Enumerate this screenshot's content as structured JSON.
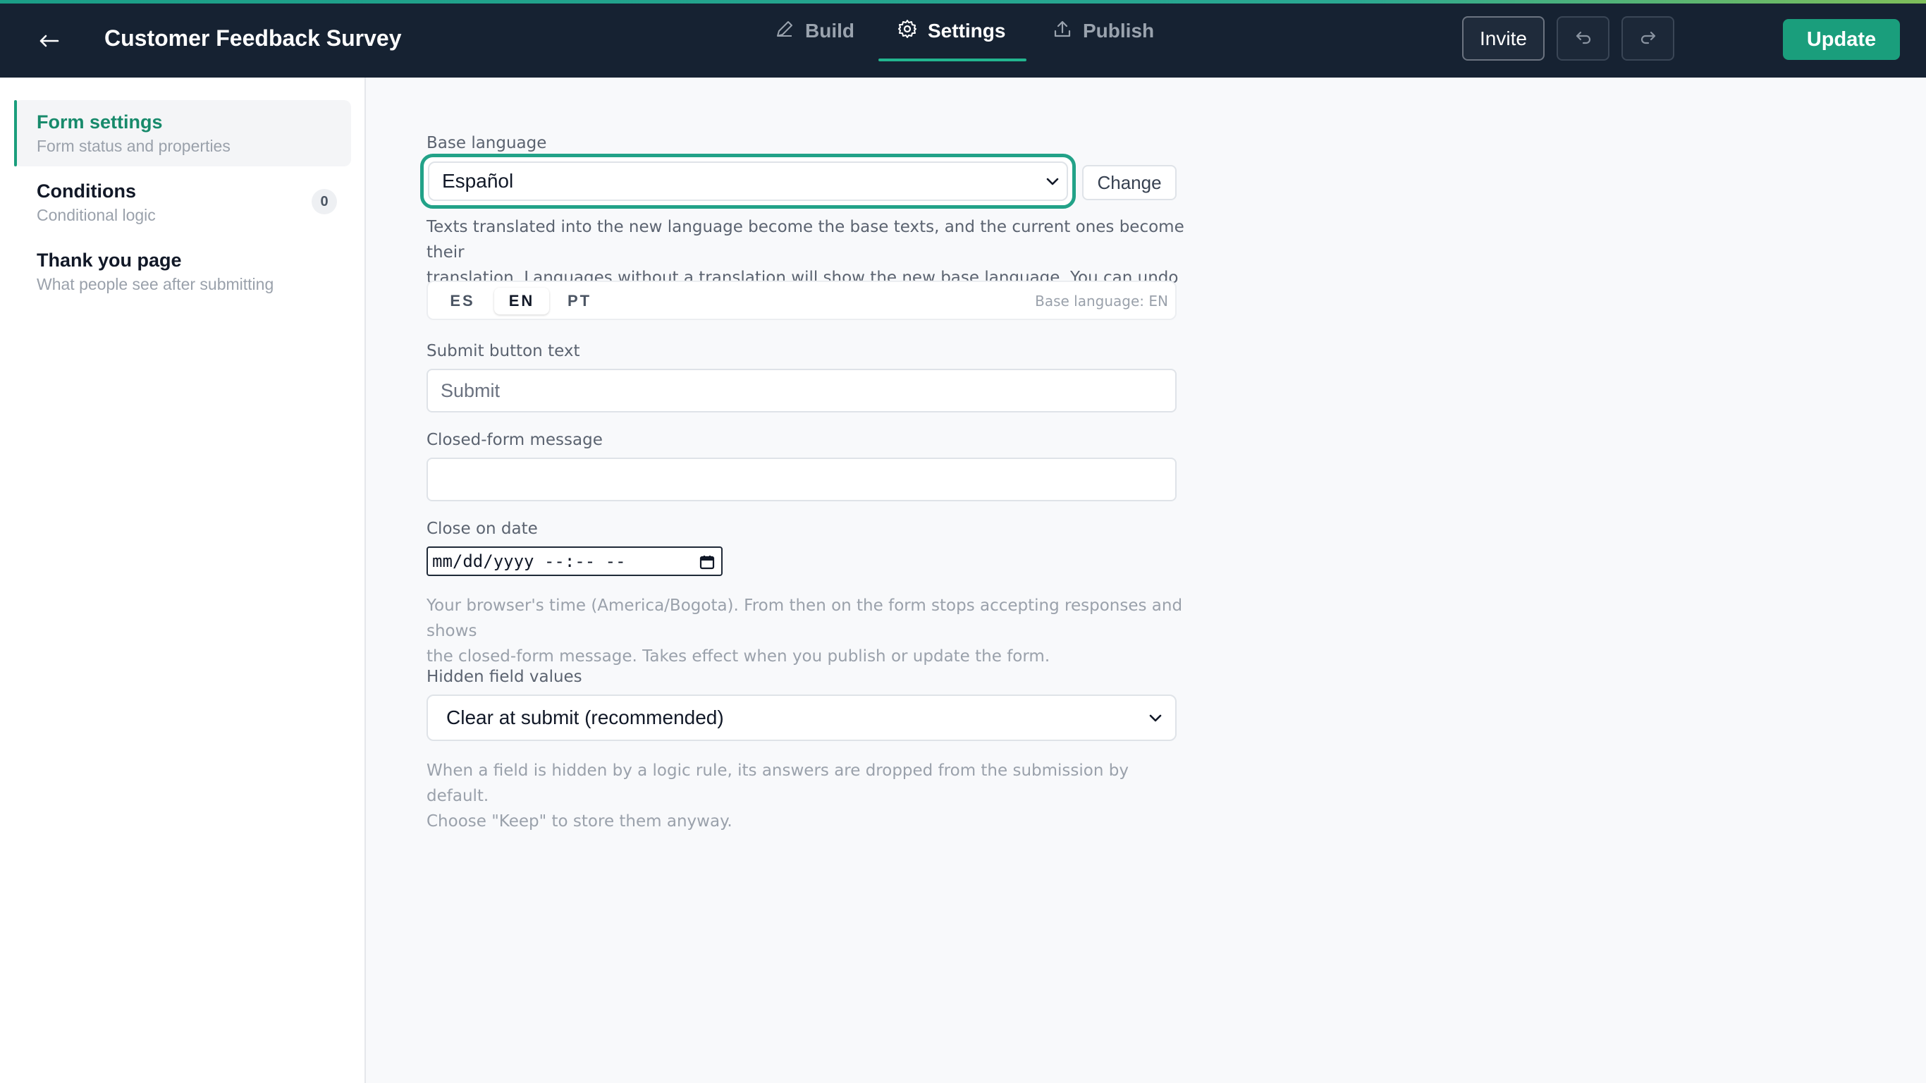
{
  "header": {
    "title": "Customer Feedback Survey",
    "tabs": {
      "build": "Build",
      "settings": "Settings",
      "publish": "Publish"
    },
    "invite_label": "Invite",
    "update_label": "Update"
  },
  "sidebar": {
    "items": [
      {
        "label": "Form settings",
        "sub": "Form status and properties"
      },
      {
        "label": "Conditions",
        "sub": "Conditional logic",
        "badge": "0"
      },
      {
        "label": "Thank you page",
        "sub": "What people see after submitting"
      }
    ]
  },
  "settings": {
    "base_language_label": "Base language",
    "base_language_value": "Español",
    "change_label": "Change",
    "base_language_help": [
      "Texts translated into the new language become the base texts, and the current ones become their",
      "translation. Languages without a translation will show the new base language. You can undo this."
    ],
    "language_tabs": [
      "ES",
      "EN",
      "PT"
    ],
    "active_language": "EN",
    "base_language_indicator": "Base language: EN",
    "submit_label": "Submit button text",
    "submit_placeholder": "Submit",
    "closed_label": "Closed-form message",
    "closed_value": "",
    "close_date_label": "Close on date",
    "close_date_value": "mm/dd/yyyy --:-- --",
    "close_date_help": [
      "Your browser's time (America/Bogota). From then on the form stops accepting responses and shows",
      "the closed-form message. Takes effect when you publish or update the form."
    ],
    "hidden_label": "Hidden field values",
    "hidden_value": "Clear at submit (recommended)",
    "hidden_help": [
      "When a field is hidden by a logic rule, its answers are dropped from the submission by default.",
      "Choose \"Keep\" to store them anyway."
    ]
  },
  "colors": {
    "header_bg": "#162232",
    "accent": "#1a9e7c",
    "focus_ring": "#22a288"
  }
}
